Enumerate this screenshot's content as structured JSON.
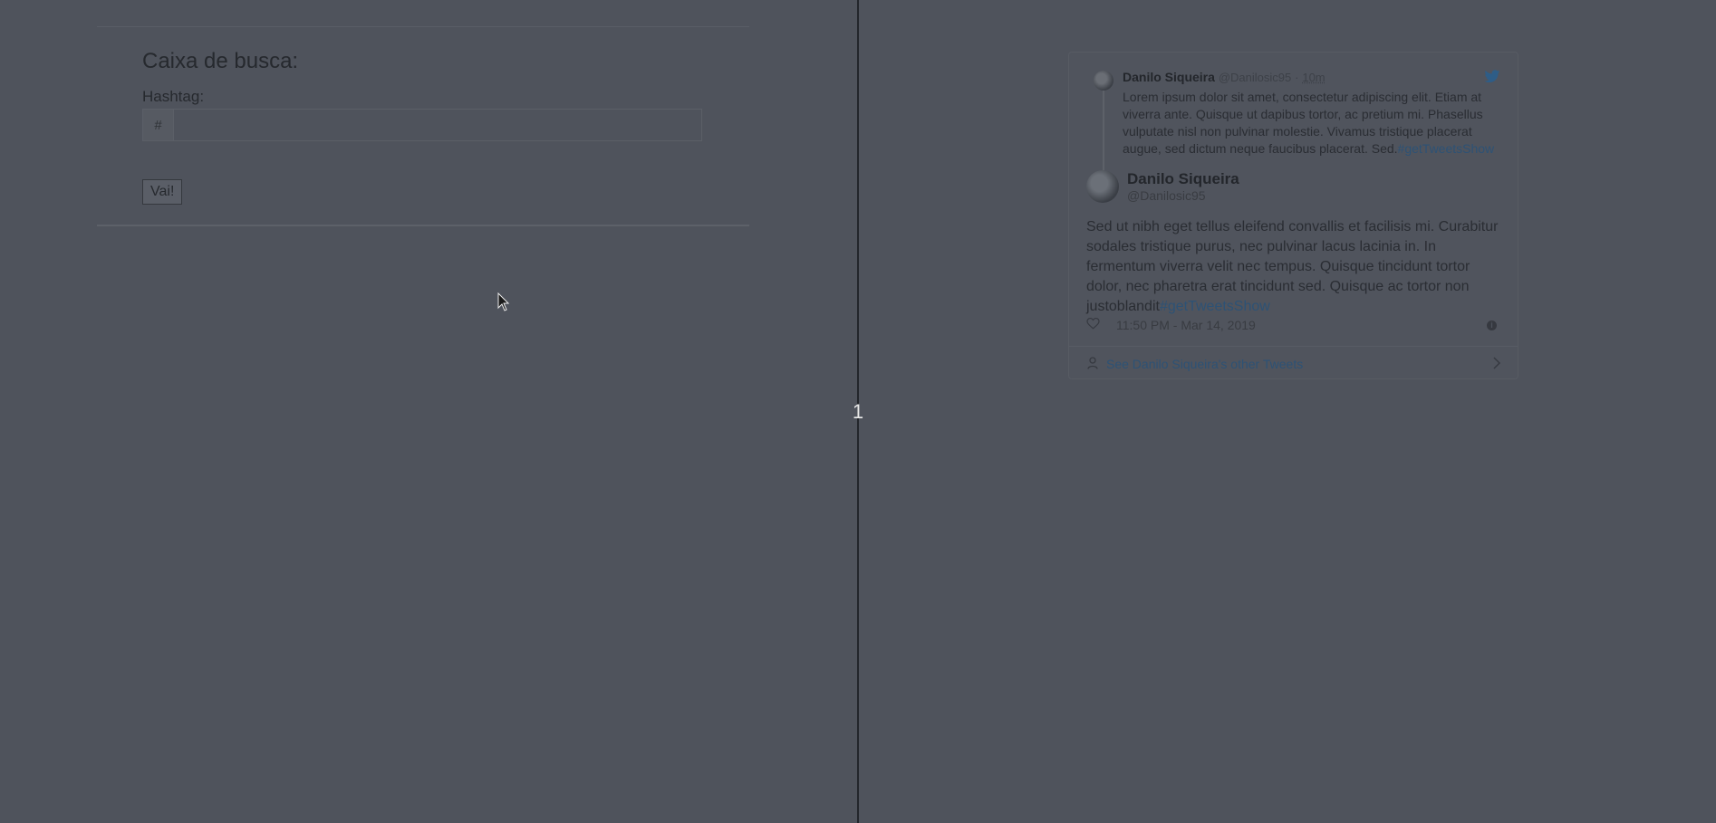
{
  "search": {
    "title": "Caixa de busca:",
    "hashtag_label": "Hashtag:",
    "prefix": "#",
    "value": "",
    "placeholder": "",
    "button_label": "Vai!"
  },
  "divider": {
    "handle_label": "1"
  },
  "tweet": {
    "reply": {
      "author": "Danilo Siqueira",
      "handle": "@Danilosic95",
      "separator": "·",
      "age": "10m",
      "text": "Lorem ipsum dolor sit amet, consectetur adipiscing elit. Etiam at viverra ante. Quisque ut dapibus tortor, ac pretium mi. Phasellus vulputate nisl non pulvinar molestie. Vivamus tristique placerat augue, sed dictum neque faucibus placerat. Sed.",
      "hashtag": "#getTweetsShow"
    },
    "main": {
      "author": "Danilo Siqueira",
      "handle": "@Danilosic95",
      "text": "Sed ut nibh eget tellus eleifend convallis et facilisis mi. Curabitur sodales tristique purus, nec pulvinar lacus lacinia in. In fermentum viverra velit nec tempus. Quisque tincidunt tortor dolor, nec pharetra erat tincidunt sed. Quisque ac tortor non justoblandit",
      "hashtag": "#getTweetsShow",
      "timestamp": "11:50 PM - Mar 14, 2019"
    },
    "other_tweets_label": "See Danilo Siqueira's other Tweets"
  },
  "icons": {
    "twitter": "twitter-bird-icon",
    "heart": "heart-icon",
    "info": "info-icon",
    "person": "person-icon",
    "chevron": "chevron-right-icon",
    "cursor": "mouse-cursor-icon"
  },
  "colors": {
    "overlay_background": "#4f535c",
    "link": "#2d5275",
    "divider": "#23262b"
  }
}
